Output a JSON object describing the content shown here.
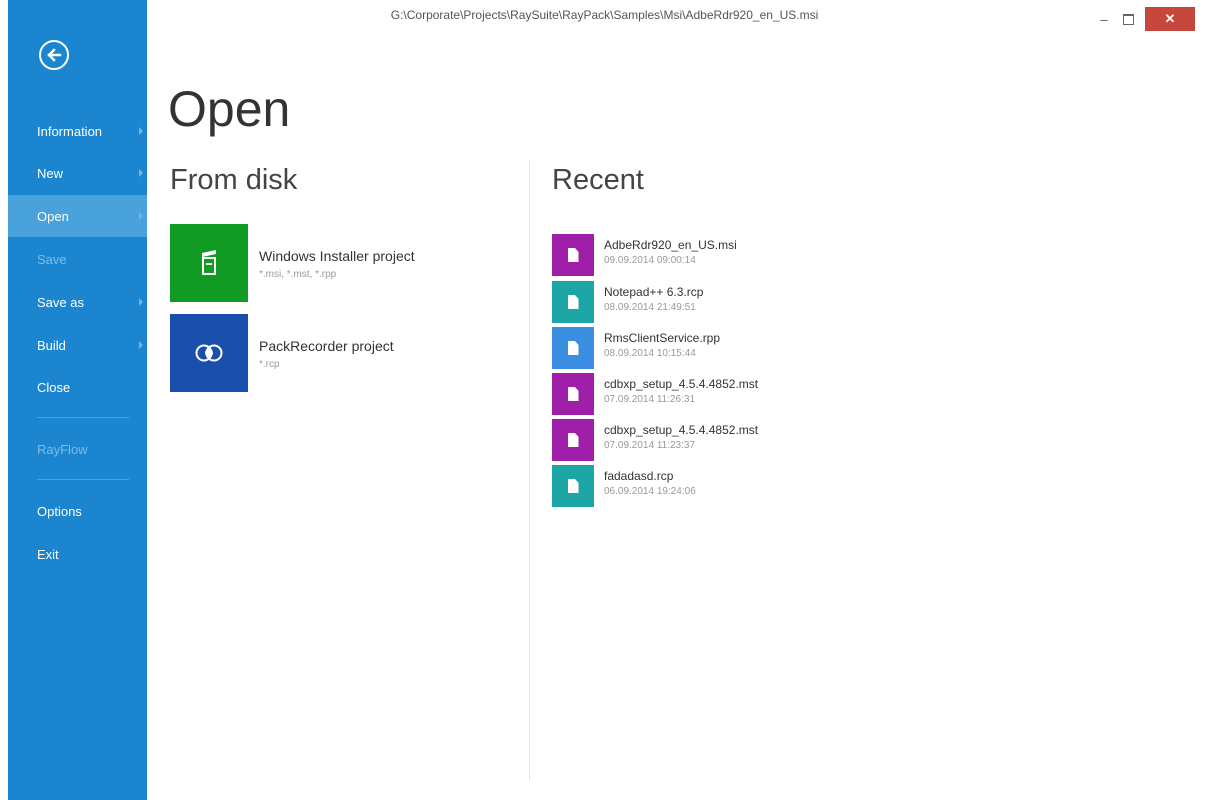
{
  "window": {
    "path": "G:\\Corporate\\Projects\\RaySuite\\RayPack\\Samples\\Msi\\AdbeRdr920_en_US.msi",
    "minimize_glyph": "–",
    "close_glyph": "✕"
  },
  "sidebar": {
    "back_icon": "back-arrow-icon",
    "items": [
      {
        "label": "Information",
        "has_arrow": true
      },
      {
        "label": "New",
        "has_arrow": true
      },
      {
        "label": "Open",
        "has_arrow": true,
        "active": true
      },
      {
        "label": "Save",
        "disabled": true
      },
      {
        "label": "Save as",
        "has_arrow": true
      },
      {
        "label": "Build",
        "has_arrow": true
      },
      {
        "label": "Close"
      },
      {
        "label": "RayFlow",
        "disabled": true
      },
      {
        "label": "Options"
      },
      {
        "label": "Exit"
      }
    ]
  },
  "main": {
    "title": "Open",
    "from_disk": {
      "heading": "From disk",
      "items": [
        {
          "name": "Windows Installer project",
          "extensions": "*.msi, *.mst, *.rpp",
          "color": "#119b24",
          "icon": "msi-package-icon"
        },
        {
          "name": "PackRecorder project",
          "extensions": "*.rcp",
          "color": "#1b4fad",
          "icon": "packrecorder-icon"
        }
      ]
    },
    "recent": {
      "heading": "Recent",
      "items": [
        {
          "name": "AdbeRdr920_en_US.msi",
          "date": "09.09.2014 09:00:14",
          "color": "#a01fa8"
        },
        {
          "name": "Notepad++ 6.3.rcp",
          "date": "08.09.2014 21:49:51",
          "color": "#1ea6a7"
        },
        {
          "name": "RmsClientService.rpp",
          "date": "08.09.2014 10:15:44",
          "color": "#3b8fe2"
        },
        {
          "name": "cdbxp_setup_4.5.4.4852.mst",
          "date": "07.09.2014 11:26:31",
          "color": "#a01fa8"
        },
        {
          "name": "cdbxp_setup_4.5.4.4852.mst",
          "date": "07.09.2014 11:23:37",
          "color": "#a01fa8"
        },
        {
          "name": "fadadasd.rcp",
          "date": "06.09.2014 19:24:06",
          "color": "#1ea6a7"
        }
      ]
    }
  }
}
